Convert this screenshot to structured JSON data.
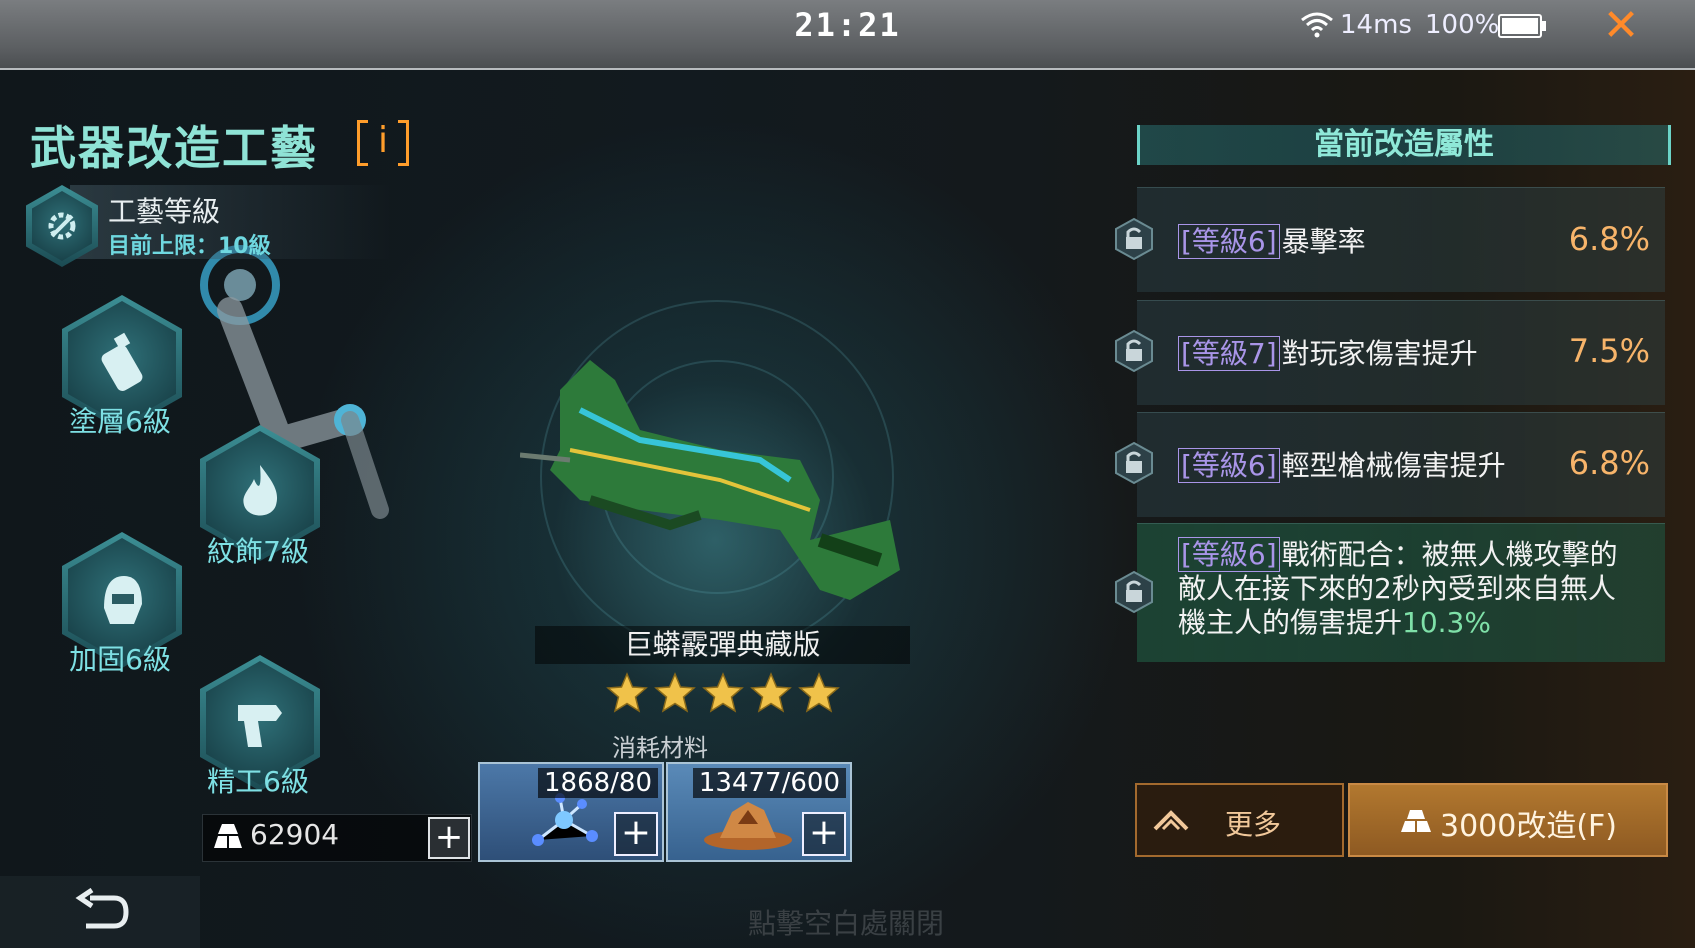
{
  "status_bar": {
    "time": "21:21",
    "ping": "14ms",
    "battery": "100%",
    "battery_level": 1.0,
    "close_icon": "close-icon"
  },
  "panel": {
    "title": "武器改造工藝",
    "info_label": "i"
  },
  "craft": {
    "title": "工藝等級",
    "limit": "目前上限：10級"
  },
  "modules": [
    {
      "label": "塗層6級",
      "icon": "spray-can-icon"
    },
    {
      "label": "紋飾7級",
      "icon": "flame-icon"
    },
    {
      "label": "加固6級",
      "icon": "helmet-icon"
    },
    {
      "label": "精工6級",
      "icon": "drill-icon"
    }
  ],
  "currency": {
    "value": "62904",
    "add_label": "+"
  },
  "weapon": {
    "name": "巨蟒霰彈典藏版",
    "stars": 5
  },
  "materials": {
    "label": "消耗材料",
    "items": [
      {
        "count": "1868/80",
        "icon": "molecule-icon",
        "add_label": "+"
      },
      {
        "count": "13477/600",
        "icon": "ore-icon",
        "add_label": "+"
      }
    ]
  },
  "properties": {
    "header": "當前改造屬性",
    "items": [
      {
        "level": "[等級6]",
        "name": "暴擊率",
        "value": "6.8%"
      },
      {
        "level": "[等級7]",
        "name": "對玩家傷害提升",
        "value": "7.5%"
      },
      {
        "level": "[等級6]",
        "name": "輕型槍械傷害提升",
        "value": "6.8%"
      },
      {
        "level": "[等級6]",
        "name": "戰術配合：被無人機攻擊的敵人在接下來的2秒內受到來自無人機主人的傷害提升",
        "value": "10.3%"
      }
    ]
  },
  "actions": {
    "more": "更多",
    "upgrade": "3000改造(F)"
  },
  "hint": "點擊空白處關閉",
  "colors": {
    "accent": "#8fe3d6",
    "value_orange": "#f7b46a",
    "level_purple": "#a995e8",
    "close_orange": "#ff8a2a"
  }
}
